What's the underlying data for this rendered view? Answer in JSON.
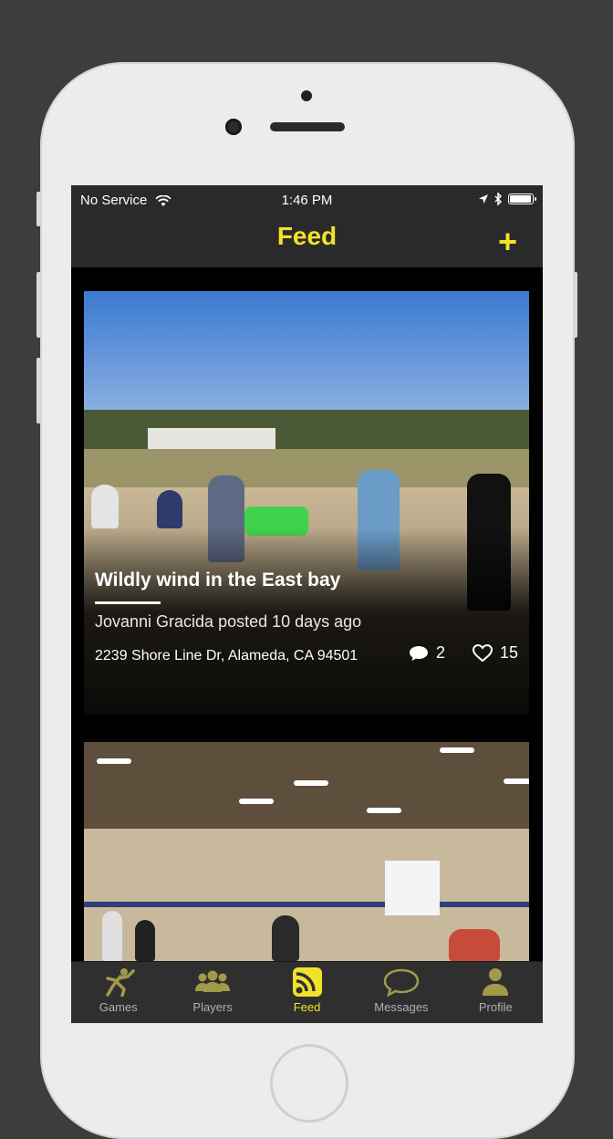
{
  "status_bar": {
    "carrier": "No Service",
    "time": "1:46 PM",
    "battery_level": 0.95
  },
  "nav": {
    "title": "Feed",
    "add_label": "+"
  },
  "feed": {
    "posts": [
      {
        "title": "Wildly wind in the East bay",
        "byline": "Jovanni Gracida posted 10 days ago",
        "address": "2239 Shore Line Dr, Alameda, CA 94501",
        "comments": "2",
        "likes": "15"
      }
    ]
  },
  "tabs": [
    {
      "label": "Games",
      "icon": "player-throw-icon"
    },
    {
      "label": "Players",
      "icon": "group-icon"
    },
    {
      "label": "Feed",
      "icon": "rss-feed-icon"
    },
    {
      "label": "Messages",
      "icon": "speech-bubble-icon"
    },
    {
      "label": "Profile",
      "icon": "person-icon"
    }
  ],
  "colors": {
    "accent": "#f2e12a",
    "bar_background": "#2a2a2c",
    "tab_inactive": "#b0b0b0",
    "frame_background": "#3d3d3d"
  }
}
